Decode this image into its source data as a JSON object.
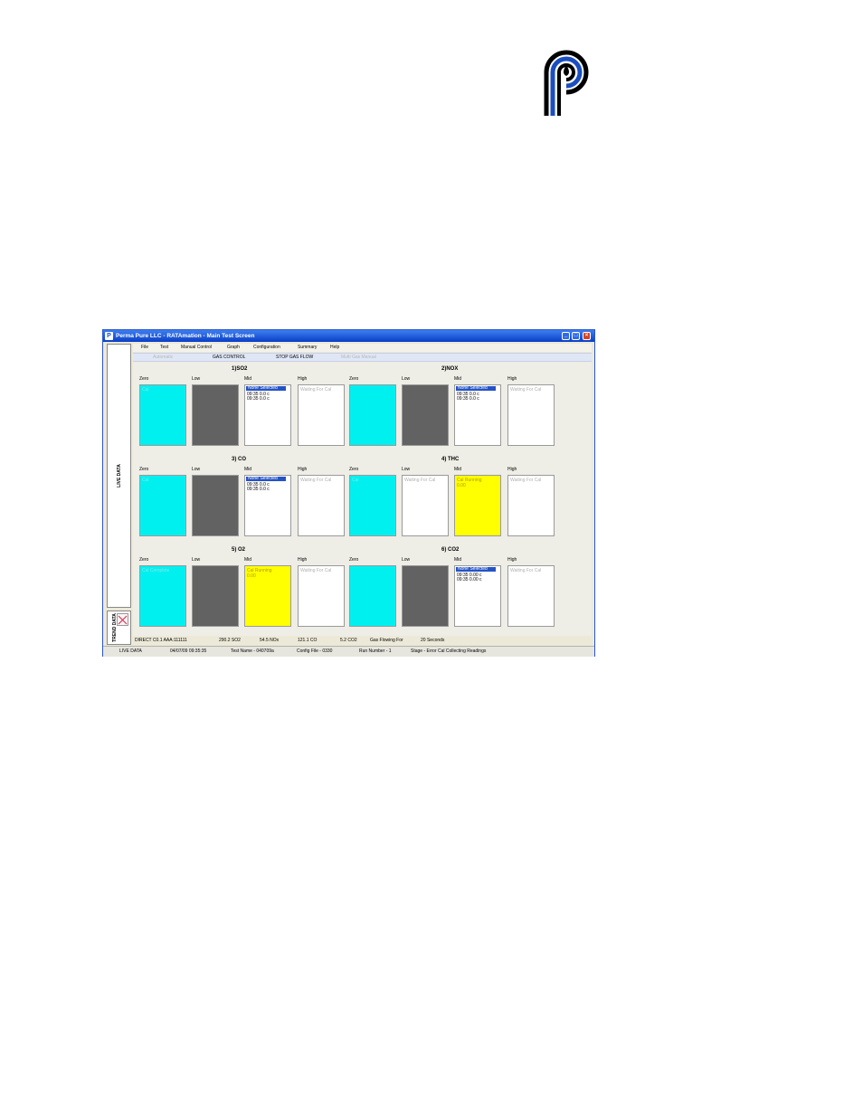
{
  "window": {
    "title": "Perma Pure LLC - RATAmation - Main Test Screen",
    "minimize_glyph": "_",
    "maximize_glyph": "□",
    "close_glyph": "×"
  },
  "side_tabs": {
    "live_data": "LIVE DATA",
    "trend_data": "TREND DATA"
  },
  "menu": [
    "File",
    "Test",
    "Manual Control",
    "Graph",
    "Configuration",
    "Summary",
    "Help"
  ],
  "toolbar": [
    "Automatic",
    "GAS CONTROL",
    "STOP GAS FLOW",
    "Multi Gas Manual"
  ],
  "gases": [
    {
      "title": "1)SO2",
      "cells": [
        {
          "label": "Zero",
          "color": "cyan",
          "text": "Cal"
        },
        {
          "label": "Low",
          "color": "gray",
          "text": ""
        },
        {
          "label": "Mid",
          "color": "white",
          "selected": "None Selected",
          "rows": [
            "09:35  0.0 c",
            "09:35  0.0 c"
          ]
        },
        {
          "label": "High",
          "color": "white",
          "text": "Waiting For Cal"
        }
      ]
    },
    {
      "title": "2)NOX",
      "cells": [
        {
          "label": "Zero",
          "color": "cyan",
          "text": ""
        },
        {
          "label": "Low",
          "color": "gray",
          "text": ""
        },
        {
          "label": "Mid",
          "color": "white",
          "selected": "None Selected",
          "rows": [
            "09:35  0.0 c",
            "09:35  0.0 c"
          ]
        },
        {
          "label": "High",
          "color": "white",
          "text": "Waiting For Cal"
        }
      ]
    },
    {
      "title": "3) CO",
      "cells": [
        {
          "label": "Zero",
          "color": "cyan",
          "text": "Cal"
        },
        {
          "label": "Low",
          "color": "gray",
          "text": ""
        },
        {
          "label": "Mid",
          "color": "white",
          "selected": "None Selected",
          "rows": [
            "09:35  0.0 c",
            "09:35  0.0 c"
          ]
        },
        {
          "label": "High",
          "color": "white",
          "text": "Waiting For Cal"
        }
      ]
    },
    {
      "title": "4) THC",
      "cells": [
        {
          "label": "Zero",
          "color": "cyan",
          "text": "Cal"
        },
        {
          "label": "Low",
          "color": "white",
          "text": "Waiting For Cal"
        },
        {
          "label": "Mid",
          "color": "yellow",
          "text": "Cal Running",
          "text2": "0.00"
        },
        {
          "label": "High",
          "color": "white",
          "text": "Waiting For Cal"
        }
      ]
    },
    {
      "title": "5) O2",
      "cells": [
        {
          "label": "Zero",
          "color": "cyan",
          "text": "Cal Complete"
        },
        {
          "label": "Low",
          "color": "gray",
          "text": ""
        },
        {
          "label": "Mid",
          "color": "yellow",
          "text": "Cal Running",
          "text2": "0.00"
        },
        {
          "label": "High",
          "color": "white",
          "text": "Waiting For Cal"
        }
      ]
    },
    {
      "title": "6) CO2",
      "cells": [
        {
          "label": "Zero",
          "color": "cyan",
          "text": ""
        },
        {
          "label": "Low",
          "color": "gray",
          "text": ""
        },
        {
          "label": "Mid",
          "color": "white",
          "selected": "None Selected",
          "rows": [
            "09:35  0.00 c",
            "09:35  0.00 c"
          ]
        },
        {
          "label": "High",
          "color": "white",
          "text": "Waiting For Cal"
        }
      ]
    }
  ],
  "readings": [
    "DIRECT C0.1  AAA:111111",
    "290.2  SO2",
    "54.5  NOx",
    "121.1  CO",
    "5.2  CO2",
    "Gas Flowing For",
    "20 Seconds"
  ],
  "statusbar": [
    "LIVE DATA",
    "04/07/09 09:35:35",
    "Test Name - 040709a",
    "Config File - 0330",
    "Run Number -  1",
    "Stage - Error Cal Collecting Readings"
  ],
  "colors": {
    "cyan": "#00f0f0",
    "gray": "#626262",
    "yellow": "#ffff00",
    "title_blue": "#0a3fc7",
    "logo_blue": "#1b4fc0"
  }
}
